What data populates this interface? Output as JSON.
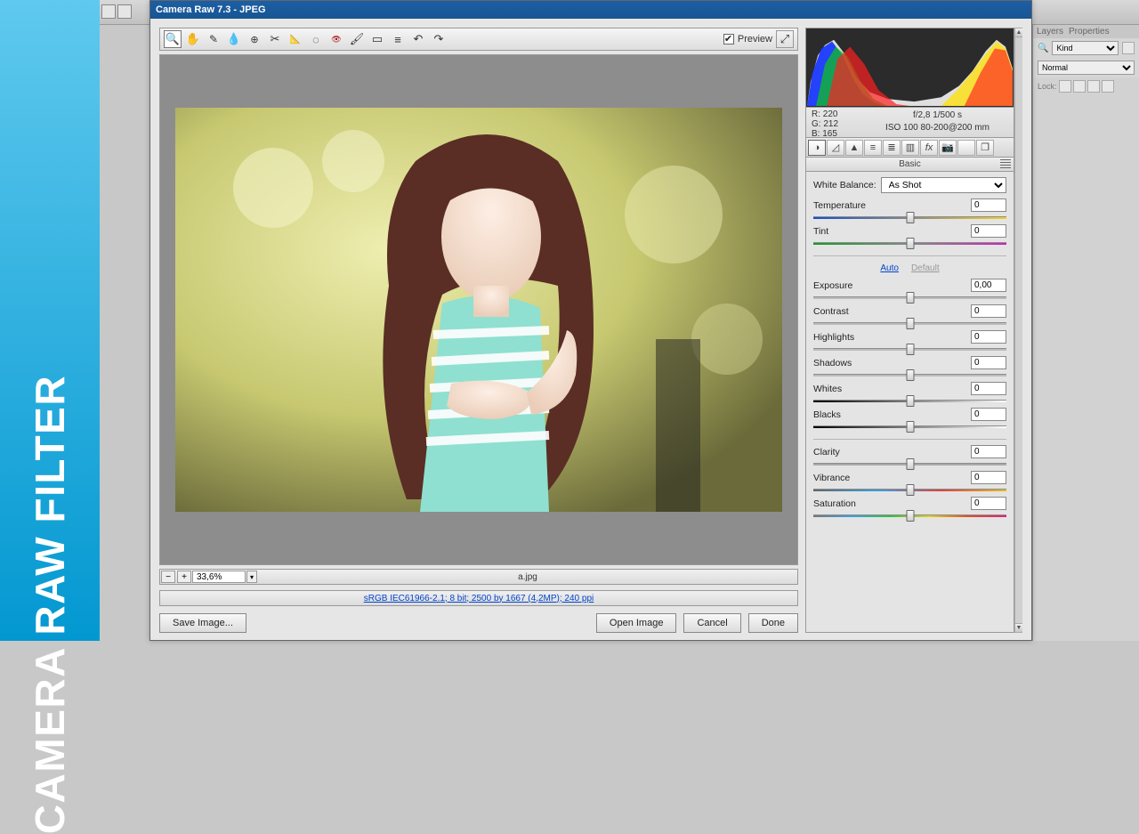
{
  "banner": {
    "text": "CAMERA RAW FILTER"
  },
  "ps": {
    "panels": {
      "tab1": "Layers",
      "tab2": "Properties",
      "kind_placeholder": "Kind",
      "blend_mode": "Normal",
      "lock_label": "Lock:"
    }
  },
  "cr": {
    "title": "Camera Raw 7.3  -  JPEG",
    "preview_label": "Preview",
    "zoom_value": "33,6%",
    "filename": "a.jpg",
    "metadata_link": "sRGB IEC61966-2.1; 8 bit; 2500 by 1667 (4,2MP); 240 ppi",
    "buttons": {
      "save": "Save Image...",
      "open": "Open Image",
      "cancel": "Cancel",
      "done": "Done"
    },
    "rgb": {
      "r_label": "R:",
      "r": "220",
      "g_label": "G:",
      "g": "212",
      "b_label": "B:",
      "b": "165"
    },
    "exif": {
      "line1": "f/2,8     1/500 s",
      "line2": "ISO 100    80-200@200 mm"
    },
    "basic": {
      "title": "Basic",
      "wb_label": "White Balance:",
      "wb_value": "As Shot",
      "auto": "Auto",
      "default": "Default",
      "sliders": {
        "temperature": {
          "label": "Temperature",
          "value": "0",
          "grad": "grad-temp",
          "pos": 50
        },
        "tint": {
          "label": "Tint",
          "value": "0",
          "grad": "grad-tint",
          "pos": 50
        },
        "exposure": {
          "label": "Exposure",
          "value": "0,00",
          "grad": "",
          "pos": 50
        },
        "contrast": {
          "label": "Contrast",
          "value": "0",
          "grad": "",
          "pos": 50
        },
        "highlights": {
          "label": "Highlights",
          "value": "0",
          "grad": "",
          "pos": 50
        },
        "shadows": {
          "label": "Shadows",
          "value": "0",
          "grad": "",
          "pos": 50
        },
        "whites": {
          "label": "Whites",
          "value": "0",
          "grad": "grad-white",
          "pos": 50
        },
        "blacks": {
          "label": "Blacks",
          "value": "0",
          "grad": "grad-black",
          "pos": 50
        },
        "clarity": {
          "label": "Clarity",
          "value": "0",
          "grad": "grad-clar",
          "pos": 50
        },
        "vibrance": {
          "label": "Vibrance",
          "value": "0",
          "grad": "grad-vib",
          "pos": 50
        },
        "saturation": {
          "label": "Saturation",
          "value": "0",
          "grad": "grad-sat",
          "pos": 50
        }
      }
    }
  }
}
